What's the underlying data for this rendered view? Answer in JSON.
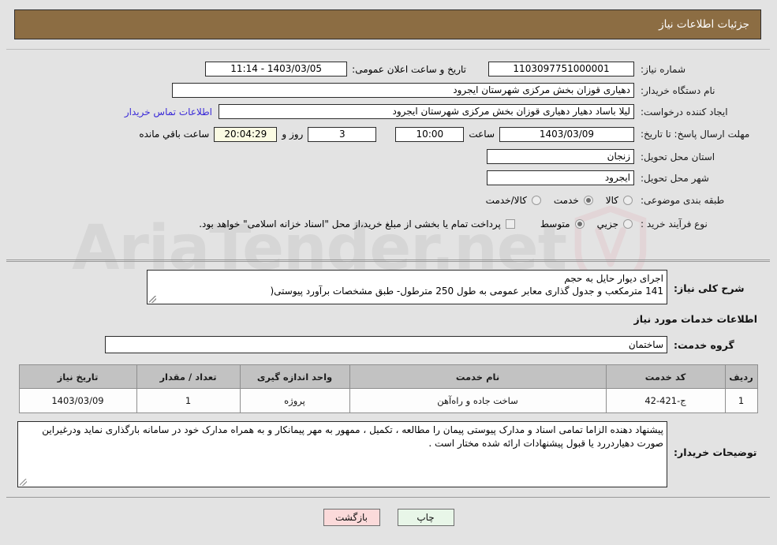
{
  "header": {
    "title": "جزئیات اطلاعات نیاز"
  },
  "colors": {
    "header_bg": "#8c6d43",
    "page_bg": "#e3e3e3",
    "link": "#3a2ad8",
    "table_header_bg": "#c2c2c2",
    "timer_bg": "#fbfbe3",
    "btn_print_bg": "#e8f6e8",
    "btn_back_bg": "#fbdada"
  },
  "watermark": {
    "text": "AriaTender.net"
  },
  "top_form": {
    "need_number_label": "شماره نیاز:",
    "need_number_value": "1103097751000001",
    "announce_datetime_label": "تاریخ و ساعت اعلان عمومی:",
    "announce_datetime_value": "1403/03/05 - 11:14",
    "buyer_org_label": "نام دستگاه خریدار:",
    "buyer_org_value": "دهیاری قوزان بخش مرکزی شهرستان ایجرود",
    "creator_label": "ایجاد کننده درخواست:",
    "creator_value": "لیلا باساد دهیار دهیاری قوزان بخش مرکزی شهرستان ایجرود",
    "contact_link": "اطلاعات تماس خریدار",
    "deadline_label": "مهلت ارسال پاسخ: تا تاریخ:",
    "deadline_date": "1403/03/09",
    "time_label": "ساعت",
    "deadline_time": "10:00",
    "days_value": "3",
    "days_label": "روز و",
    "remaining_clock": "20:04:29",
    "remaining_label": "ساعت باقي مانده",
    "province_label": "استان محل تحویل:",
    "province_value": "زنجان",
    "city_label": "شهر محل تحویل:",
    "city_value": "ایجرود",
    "category_label": "طبقه بندی موضوعی:",
    "category_options": [
      {
        "label": "کالا",
        "selected": false
      },
      {
        "label": "خدمت",
        "selected": true
      },
      {
        "label": "کالا/خدمت",
        "selected": false
      }
    ],
    "process_label": "نوع فرآیند خرید :",
    "process_options": [
      {
        "label": "جزیي",
        "selected": false
      },
      {
        "label": "متوسط",
        "selected": true
      }
    ],
    "treasury_checkbox_text": "پرداخت تمام یا بخشی از مبلغ خرید،از محل \"اسناد خزانه اسلامی\" خواهد بود.",
    "treasury_checked": false
  },
  "middle": {
    "summary_label": "شرح کلی نیاز:",
    "summary_value": "اجرای دیوار حایل به حجم\n141 مترمکعب و جدول گذاری معابر عمومی به طول 250 مترطول- طبق مشخصات برآورد پیوستی(",
    "services_section_title": "اطلاعات خدمات مورد نیاز",
    "service_group_label": "گروه خدمت:",
    "service_group_value": "ساختمان",
    "table": {
      "columns": [
        "ردیف",
        "کد خدمت",
        "نام خدمت",
        "واحد اندازه گیری",
        "تعداد / مقدار",
        "تاریخ نیاز"
      ],
      "rows": [
        {
          "radif": "1",
          "code": "ج-421-42",
          "name": "ساخت جاده و راه‌آهن",
          "unit": "پروژه",
          "qty": "1",
          "date": "1403/03/09"
        }
      ]
    },
    "buyer_notes_label": "توضیحات خریدار:",
    "buyer_notes_value": "پیشنهاد دهنده الزاما تمامی اسناد و مدارک پیوستی پیمان را مطالعه ، تکمیل ، ممهور به مهر پیمانکار و به همراه مدارک خود در سامانه بارگذاری نماید ودرغیراین صورت دهیاردررد یا قبول پیشنهادات ارائه شده مختار است ."
  },
  "buttons": {
    "print": "چاپ",
    "back": "بازگشت"
  }
}
